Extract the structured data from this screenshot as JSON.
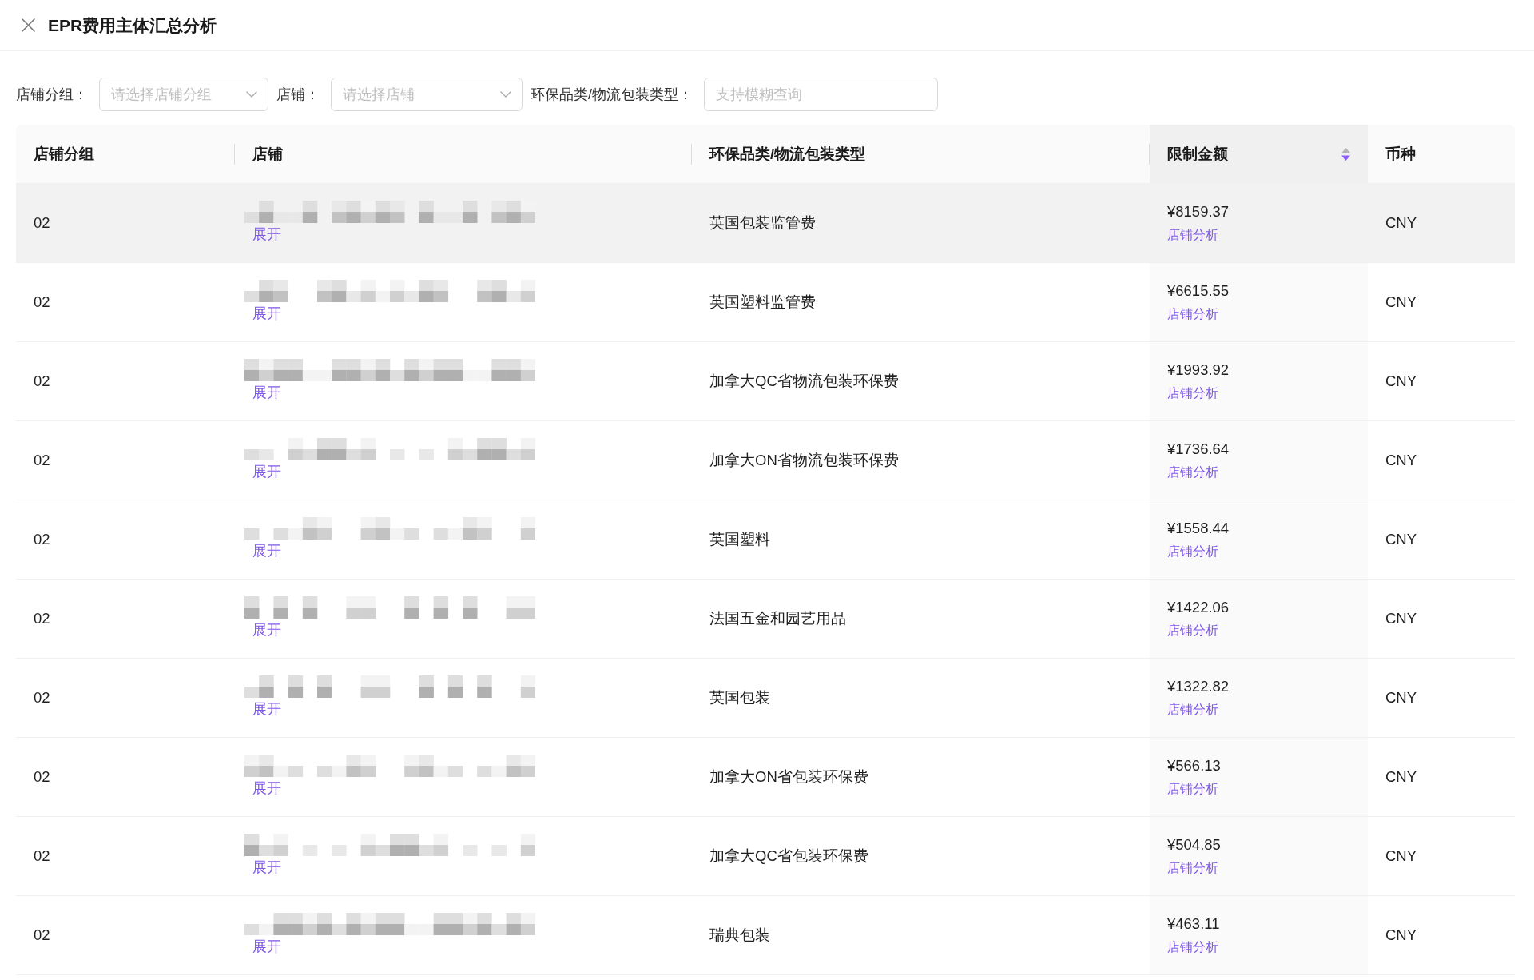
{
  "header": {
    "title": "EPR费用主体汇总分析"
  },
  "filters": [
    {
      "kind": "select",
      "label": "店铺分组：",
      "placeholder": "请选择店铺分组"
    },
    {
      "kind": "select",
      "label": "店铺：",
      "placeholder": "请选择店铺"
    },
    {
      "kind": "text",
      "label": "环保品类/物流包装类型：",
      "placeholder": "支持模糊查询"
    }
  ],
  "table": {
    "columns": [
      {
        "label": "店铺分组",
        "sorted": false
      },
      {
        "label": "店铺",
        "sorted": false
      },
      {
        "label": "环保品类/物流包装类型",
        "sorted": false
      },
      {
        "label": "限制金额",
        "sorted": true,
        "descending": true
      },
      {
        "label": "币种",
        "sorted": false
      }
    ],
    "rows": [
      {
        "hovered": true,
        "group": "02",
        "store_action": "展开",
        "category": "英国包装监管费",
        "amount": "¥8159.37",
        "amount_action": "店铺分析",
        "currency": "CNY"
      },
      {
        "hovered": false,
        "group": "02",
        "store_action": "展开",
        "category": "英国塑料监管费",
        "amount": "¥6615.55",
        "amount_action": "店铺分析",
        "currency": "CNY"
      },
      {
        "hovered": false,
        "group": "02",
        "store_action": "展开",
        "category": "加拿大QC省物流包装环保费",
        "amount": "¥1993.92",
        "amount_action": "店铺分析",
        "currency": "CNY"
      },
      {
        "hovered": false,
        "group": "02",
        "store_action": "展开",
        "category": "加拿大ON省物流包装环保费",
        "amount": "¥1736.64",
        "amount_action": "店铺分析",
        "currency": "CNY"
      },
      {
        "hovered": false,
        "group": "02",
        "store_action": "展开",
        "category": "英国塑料",
        "amount": "¥1558.44",
        "amount_action": "店铺分析",
        "currency": "CNY"
      },
      {
        "hovered": false,
        "group": "02",
        "store_action": "展开",
        "category": "法国五金和园艺用品",
        "amount": "¥1422.06",
        "amount_action": "店铺分析",
        "currency": "CNY"
      },
      {
        "hovered": false,
        "group": "02",
        "store_action": "展开",
        "category": "英国包装",
        "amount": "¥1322.82",
        "amount_action": "店铺分析",
        "currency": "CNY"
      },
      {
        "hovered": false,
        "group": "02",
        "store_action": "展开",
        "category": "加拿大ON省包装环保费",
        "amount": "¥566.13",
        "amount_action": "店铺分析",
        "currency": "CNY"
      },
      {
        "hovered": false,
        "group": "02",
        "store_action": "展开",
        "category": "加拿大QC省包装环保费",
        "amount": "¥504.85",
        "amount_action": "店铺分析",
        "currency": "CNY"
      },
      {
        "hovered": false,
        "group": "02",
        "store_action": "展开",
        "category": "瑞典包装",
        "amount": "¥463.11",
        "amount_action": "店铺分析",
        "currency": "CNY"
      }
    ]
  }
}
